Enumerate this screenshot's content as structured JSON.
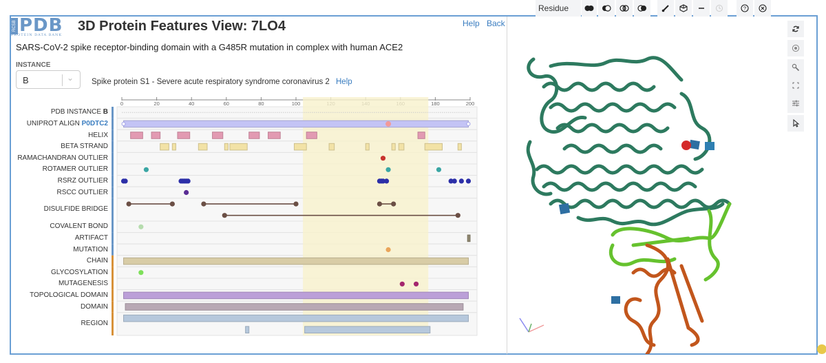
{
  "header": {
    "logo_main": "PDB",
    "logo_side": "RCSB",
    "logo_sub": "PROTEIN DATA BANK",
    "title": "3D Protein Features View: 7LO4",
    "help_link": "Help",
    "back_link": "Back",
    "subtitle": "SARS-CoV-2 spike receptor-binding domain with a G485R mutation in complex with human ACE2"
  },
  "instance": {
    "label": "INSTANCE",
    "selected": "B",
    "entity_description": "Spike protein S1 - Severe acute respiratory syndrome coronavirus 2",
    "help_link": "Help"
  },
  "toolbar": {
    "mode_label": "Residue",
    "icons": [
      "union-icon",
      "subtract-icon",
      "intersect-icon",
      "set-icon",
      "brush-icon",
      "cube-icon",
      "minus-icon",
      "history-icon",
      "help-circle-icon",
      "close-circle-icon"
    ]
  },
  "side_toolbar": [
    "reset-camera-icon",
    "screenshot-icon",
    "wrench-icon",
    "expand-icon",
    "sliders-icon",
    "cursor-icon"
  ],
  "chart_data": {
    "type": "feature-track",
    "x_axis": {
      "min": 0,
      "max": 200,
      "ticks": [
        0,
        20,
        40,
        60,
        80,
        100,
        120,
        140,
        160,
        180,
        200
      ]
    },
    "highlight_range": [
      104,
      176
    ],
    "highlight_color": "#f7f1cc",
    "tracks": [
      {
        "label": "PDB INSTANCE",
        "label_suffix": "B",
        "type": "dotted",
        "group": "pdb",
        "rows": 1
      },
      {
        "label": "UNIPROT ALIGN",
        "label_link": "P0DTC2",
        "type": "bar",
        "color": "#c3c3f5",
        "group": "pdb",
        "rows": 1,
        "features": [
          [
            1,
            199
          ]
        ],
        "points": [
          153
        ],
        "point_color": "#f29a9a"
      },
      {
        "label": "HELIX",
        "type": "blocks",
        "color": "#e29ab2",
        "group": "pdb",
        "rows": 1,
        "features": [
          [
            5,
            12
          ],
          [
            17,
            22
          ],
          [
            32,
            39
          ],
          [
            52,
            58
          ],
          [
            73,
            79
          ],
          [
            84,
            91
          ],
          [
            106,
            112
          ],
          [
            170,
            174
          ]
        ]
      },
      {
        "label": "BETA STRAND",
        "type": "blocks",
        "color": "#f2e2a6",
        "group": "pdb",
        "rows": 1,
        "features": [
          [
            22,
            27
          ],
          [
            29,
            31
          ],
          [
            44,
            49
          ],
          [
            59,
            61
          ],
          [
            62,
            72
          ],
          [
            99,
            106
          ],
          [
            119,
            122
          ],
          [
            140,
            142
          ],
          [
            155,
            157
          ],
          [
            159,
            162
          ],
          [
            174,
            184
          ],
          [
            193,
            195
          ]
        ]
      },
      {
        "label": "RAMACHANDRAN OUTLIER",
        "type": "points",
        "color": "#c8322d",
        "group": "pdb",
        "rows": 1,
        "points": [
          150
        ]
      },
      {
        "label": "ROTAMER OUTLIER",
        "type": "points",
        "color": "#3aa6a4",
        "group": "pdb",
        "rows": 1,
        "points": [
          14,
          153,
          182
        ]
      },
      {
        "label": "RSRZ OUTLIER",
        "type": "points",
        "color": "#2c2fa8",
        "group": "pdb",
        "rows": 1,
        "points": [
          1,
          2,
          34,
          35,
          36,
          37,
          38,
          148,
          149,
          150,
          152,
          189,
          191,
          195,
          199
        ]
      },
      {
        "label": "RSCC OUTLIER",
        "type": "points",
        "color": "#5a2d94",
        "group": "pdb",
        "rows": 1,
        "points": [
          37
        ]
      },
      {
        "label": "DISULFIDE BRIDGE",
        "type": "bonds",
        "color": "#6b4f45",
        "group": "pdb",
        "rows": 2,
        "bonds": [
          [
            4,
            29,
            0
          ],
          [
            47,
            100,
            0
          ],
          [
            148,
            156,
            0
          ],
          [
            59,
            193,
            1
          ]
        ]
      },
      {
        "label": "COVALENT BOND",
        "type": "points",
        "color": "#b6dcae",
        "group": "pdb",
        "rows": 1,
        "points": [
          11
        ]
      },
      {
        "label": "ARTIFACT",
        "type": "blocks",
        "color": "#8f8770",
        "group": "pdb",
        "rows": 1,
        "features": [
          [
            198.5,
            200
          ]
        ]
      },
      {
        "label": "MUTATION",
        "type": "points",
        "color": "#eaa55a",
        "group": "pdb",
        "rows": 1,
        "points": [
          153
        ]
      },
      {
        "label": "CHAIN",
        "type": "bar",
        "color": "#d8cca6",
        "group": "uniprot",
        "rows": 1,
        "features": [
          [
            1,
            199
          ]
        ]
      },
      {
        "label": "GLYCOSYLATION",
        "type": "points",
        "color": "#7ee05a",
        "group": "uniprot",
        "rows": 1,
        "points": [
          11
        ]
      },
      {
        "label": "MUTAGENESIS",
        "type": "points",
        "color": "#a4266e",
        "group": "uniprot",
        "rows": 1,
        "points": [
          161,
          169
        ]
      },
      {
        "label": "TOPOLOGICAL DOMAIN",
        "type": "bar",
        "color": "#bb9fd8",
        "group": "uniprot",
        "rows": 1,
        "features": [
          [
            1,
            199
          ]
        ]
      },
      {
        "label": "DOMAIN",
        "type": "bar",
        "color": "#b8a8b4",
        "group": "uniprot",
        "rows": 1,
        "features": [
          [
            2,
            196
          ]
        ]
      },
      {
        "label": "REGION",
        "type": "bar",
        "color": "#b6c8dc",
        "group": "uniprot",
        "rows": 2,
        "features": [
          [
            1,
            199,
            0
          ],
          [
            71,
            73,
            1
          ],
          [
            105,
            177,
            1
          ]
        ]
      }
    ],
    "group_colors": {
      "pdb": "#6a97c7",
      "uniprot": "#d8923a"
    }
  }
}
